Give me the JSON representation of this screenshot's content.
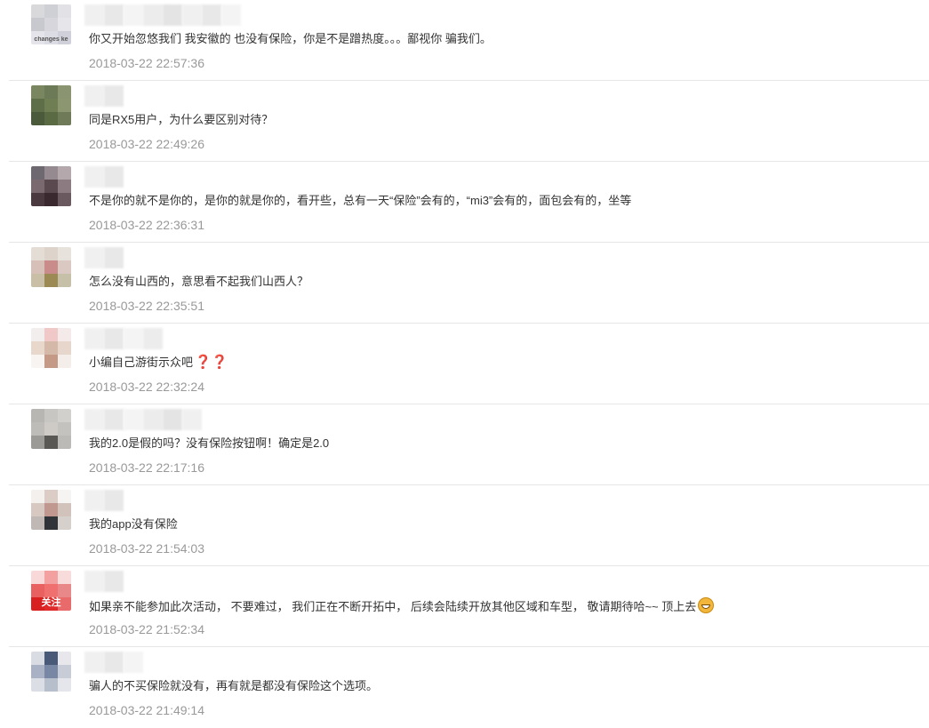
{
  "comments": [
    {
      "text": "你又开始忽悠我们 我安徽的 也没有保险，你是不是蹭热度。。。鄙视你 骗我们。",
      "time": "2018-03-22 22:57:36",
      "avatar_label": "changes ke",
      "avatar_colors": [
        "#d9d9dc",
        "#cfcfd6",
        "#e2e2e6",
        "#c8c8cf",
        "#d6d6dc",
        "#e6e6ea",
        "#e4e4ea",
        "#dcdce4",
        "#d0d0da"
      ],
      "name_tiles": 8
    },
    {
      "text": "同是RX5用户，为什么要区别对待？",
      "time": "2018-03-22 22:49:26",
      "avatar_colors": [
        "#7a8660",
        "#6c7a58",
        "#8a9470",
        "#5e6e48",
        "#707e54",
        "#8c9670",
        "#4a5a3a",
        "#5a6a42",
        "#6e7a58"
      ],
      "name_tiles": 2
    },
    {
      "text": "不是你的就不是你的，是你的就是你的，看开些，总有一天“保险”会有的，“mi3”会有的，面包会有的，坐等",
      "time": "2018-03-22 22:36:31",
      "avatar_colors": [
        "#6e6870",
        "#958a90",
        "#b5a8ac",
        "#7a6a70",
        "#5a4a50",
        "#8c7c82",
        "#4a3a40",
        "#3a2a30",
        "#6a5a60"
      ],
      "name_tiles": 2
    },
    {
      "text": "怎么没有山西的，意思看不起我们山西人？",
      "time": "2018-03-22 22:35:51",
      "avatar_colors": [
        "#e4ddd6",
        "#ddd3cb",
        "#e8e2dc",
        "#d7c0b7",
        "#c98c8a",
        "#d9c9c2",
        "#c9bfa6",
        "#9b8a54",
        "#c7c0a8"
      ],
      "name_tiles": 2
    },
    {
      "text": "小编自己游街示众吧",
      "time": "2018-03-22 22:32:24",
      "emoji": "question",
      "emoji_text": "❓❓",
      "avatar_colors": [
        "#f2eeee",
        "#f0c8c8",
        "#f4eaea",
        "#e8d8cc",
        "#d4b8a8",
        "#e6d6cc",
        "#f8f4f2",
        "#c49a86",
        "#f4eeea"
      ],
      "name_tiles": 4
    },
    {
      "text": "我的2.0是假的吗？没有保险按钮啊！确定是2.0",
      "time": "2018-03-22 22:17:16",
      "avatar_colors": [
        "#b8b6b2",
        "#c8c6c2",
        "#d2d0cc",
        "#bebcb8",
        "#cecbc6",
        "#c4c2be",
        "#9c9a96",
        "#5a5854",
        "#bcbab6"
      ],
      "name_tiles": 6
    },
    {
      "text": "我的app没有保险",
      "time": "2018-03-22 21:54:03",
      "avatar_colors": [
        "#f4f0ee",
        "#dcccc6",
        "#f6f4f2",
        "#d8c8c2",
        "#c09890",
        "#d2c2bc",
        "#c0b8b4",
        "#303438",
        "#d6d0cc"
      ],
      "name_tiles": 2
    },
    {
      "text": "如果亲不能参加此次活动， 不要难过， 我们正在不断开拓中， 后续会陆续开放其他区域和车型， 敬请期待哈~~ 顶上去",
      "time": "2018-03-22 21:52:34",
      "emoji": "grin",
      "avatar_label": "关注",
      "avatar_colors": [
        "#f8d8d8",
        "#f2a0a0",
        "#f8dcdc",
        "#e86060",
        "#f07070",
        "#e88888",
        "#d82020",
        "#e02a2a",
        "#e86a6a"
      ],
      "name_tiles": 2
    },
    {
      "text": "骗人的不买保险就没有，再有就是都没有保险这个选项。",
      "time": "2018-03-22 21:49:14",
      "avatar_colors": [
        "#dadce4",
        "#485a78",
        "#e8e8ec",
        "#a8b2c4",
        "#7888a4",
        "#c8ccd6",
        "#dcdee6",
        "#b8bfcc",
        "#e4e6ec"
      ],
      "name_tiles": 3
    }
  ]
}
